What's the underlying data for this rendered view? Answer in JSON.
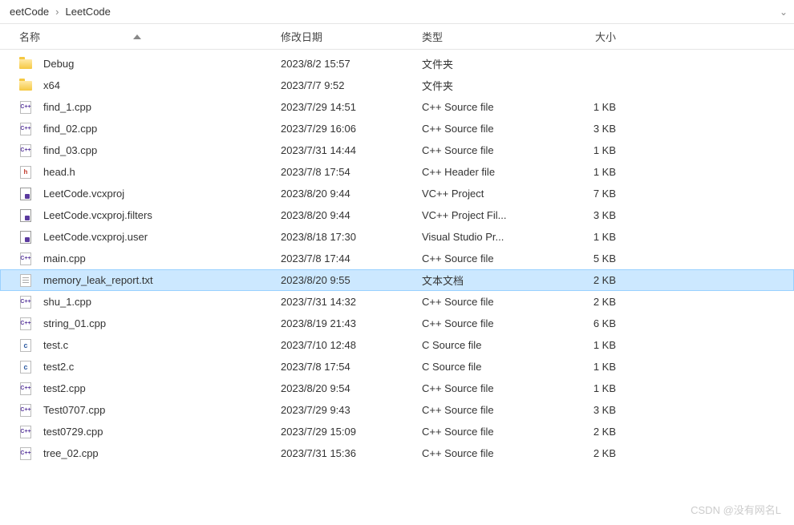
{
  "breadcrumb": {
    "item1": "eetCode",
    "item2": "LeetCode"
  },
  "columns": {
    "name": "名称",
    "date": "修改日期",
    "type": "类型",
    "size": "大小"
  },
  "files": [
    {
      "icon": "folder",
      "name": "Debug",
      "date": "2023/8/2 15:57",
      "type": "文件夹",
      "size": "",
      "selected": false
    },
    {
      "icon": "folder",
      "name": "x64",
      "date": "2023/7/7 9:52",
      "type": "文件夹",
      "size": "",
      "selected": false
    },
    {
      "icon": "cpp",
      "name": "find_1.cpp",
      "date": "2023/7/29 14:51",
      "type": "C++ Source file",
      "size": "1 KB",
      "selected": false
    },
    {
      "icon": "cpp",
      "name": "find_02.cpp",
      "date": "2023/7/29 16:06",
      "type": "C++ Source file",
      "size": "3 KB",
      "selected": false
    },
    {
      "icon": "cpp",
      "name": "find_03.cpp",
      "date": "2023/7/31 14:44",
      "type": "C++ Source file",
      "size": "1 KB",
      "selected": false
    },
    {
      "icon": "h",
      "name": "head.h",
      "date": "2023/7/8 17:54",
      "type": "C++ Header file",
      "size": "1 KB",
      "selected": false
    },
    {
      "icon": "proj",
      "name": "LeetCode.vcxproj",
      "date": "2023/8/20 9:44",
      "type": "VC++ Project",
      "size": "7 KB",
      "selected": false
    },
    {
      "icon": "proj",
      "name": "LeetCode.vcxproj.filters",
      "date": "2023/8/20 9:44",
      "type": "VC++ Project Fil...",
      "size": "3 KB",
      "selected": false
    },
    {
      "icon": "proj",
      "name": "LeetCode.vcxproj.user",
      "date": "2023/8/18 17:30",
      "type": "Visual Studio Pr...",
      "size": "1 KB",
      "selected": false
    },
    {
      "icon": "cpp",
      "name": "main.cpp",
      "date": "2023/7/8 17:44",
      "type": "C++ Source file",
      "size": "5 KB",
      "selected": false
    },
    {
      "icon": "txt",
      "name": "memory_leak_report.txt",
      "date": "2023/8/20 9:55",
      "type": "文本文档",
      "size": "2 KB",
      "selected": true
    },
    {
      "icon": "cpp",
      "name": "shu_1.cpp",
      "date": "2023/7/31 14:32",
      "type": "C++ Source file",
      "size": "2 KB",
      "selected": false
    },
    {
      "icon": "cpp",
      "name": "string_01.cpp",
      "date": "2023/8/19 21:43",
      "type": "C++ Source file",
      "size": "6 KB",
      "selected": false
    },
    {
      "icon": "c",
      "name": "test.c",
      "date": "2023/7/10 12:48",
      "type": "C Source file",
      "size": "1 KB",
      "selected": false
    },
    {
      "icon": "c",
      "name": "test2.c",
      "date": "2023/7/8 17:54",
      "type": "C Source file",
      "size": "1 KB",
      "selected": false
    },
    {
      "icon": "cpp",
      "name": "test2.cpp",
      "date": "2023/8/20 9:54",
      "type": "C++ Source file",
      "size": "1 KB",
      "selected": false
    },
    {
      "icon": "cpp",
      "name": "Test0707.cpp",
      "date": "2023/7/29 9:43",
      "type": "C++ Source file",
      "size": "3 KB",
      "selected": false
    },
    {
      "icon": "cpp",
      "name": "test0729.cpp",
      "date": "2023/7/29 15:09",
      "type": "C++ Source file",
      "size": "2 KB",
      "selected": false
    },
    {
      "icon": "cpp",
      "name": "tree_02.cpp",
      "date": "2023/7/31 15:36",
      "type": "C++ Source file",
      "size": "2 KB",
      "selected": false
    }
  ],
  "icon_labels": {
    "cpp": "C++",
    "h": "h",
    "c": "c"
  },
  "watermark": "CSDN @没有网名L"
}
